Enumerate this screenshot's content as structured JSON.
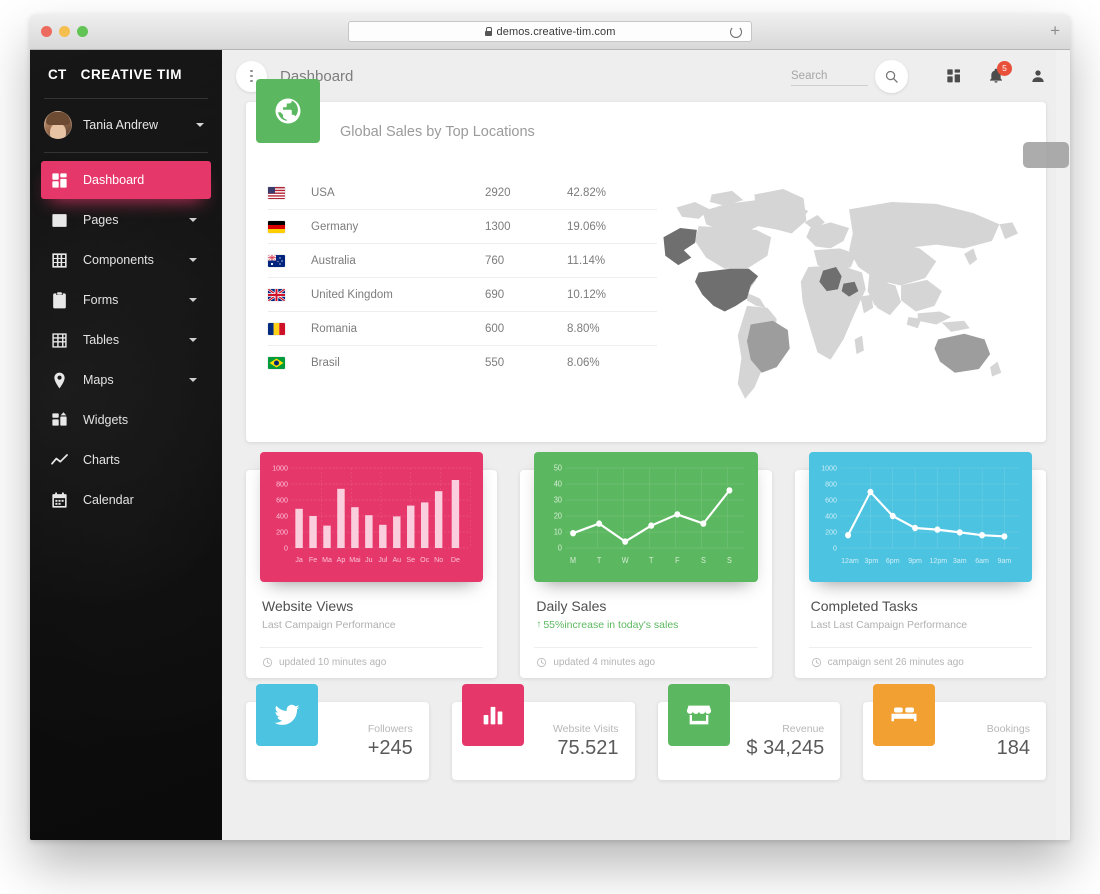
{
  "browser": {
    "url": "demos.creative-tim.com",
    "lock_icon": "lock-icon",
    "reload_icon": "reload-icon",
    "new_tab_label": "+"
  },
  "sidebar": {
    "brand_abbr": "CT",
    "brand_name": "CREATIVE TIM",
    "user": {
      "name": "Tania Andrew",
      "avatar_icon": "avatar",
      "caret_icon": "caret-down-icon"
    },
    "items": [
      {
        "label": "Dashboard",
        "icon": "dashboard-icon",
        "active": true,
        "caret": false
      },
      {
        "label": "Pages",
        "icon": "image-icon",
        "active": false,
        "caret": true
      },
      {
        "label": "Components",
        "icon": "grid-icon",
        "active": false,
        "caret": true
      },
      {
        "label": "Forms",
        "icon": "clipboard-icon",
        "active": false,
        "caret": true
      },
      {
        "label": "Tables",
        "icon": "table-icon",
        "active": false,
        "caret": true
      },
      {
        "label": "Maps",
        "icon": "pin-icon",
        "active": false,
        "caret": true
      },
      {
        "label": "Widgets",
        "icon": "widgets-icon",
        "active": false,
        "caret": false
      },
      {
        "label": "Charts",
        "icon": "chart-line-icon",
        "active": false,
        "caret": false
      },
      {
        "label": "Calendar",
        "icon": "calendar-icon",
        "active": false,
        "caret": false
      }
    ]
  },
  "topbar": {
    "menu_icon": "kebab-icon",
    "title": "Dashboard",
    "search_placeholder": "Search",
    "search_value": "",
    "search_icon": "search-icon",
    "apps_icon": "apps-grid-icon",
    "notifications_icon": "bell-icon",
    "notifications_count": "5",
    "profile_icon": "person-icon"
  },
  "map_card": {
    "title": "Global Sales by Top Locations",
    "icon": "globe-icon",
    "icon_color": "#5cb860",
    "rows": [
      {
        "flag": "us",
        "country": "USA",
        "sales": "2920",
        "percent": "42.82%"
      },
      {
        "flag": "de",
        "country": "Germany",
        "sales": "1300",
        "percent": "19.06%"
      },
      {
        "flag": "au",
        "country": "Australia",
        "sales": "760",
        "percent": "11.14%"
      },
      {
        "flag": "gb",
        "country": "United Kingdom",
        "sales": "690",
        "percent": "10.12%"
      },
      {
        "flag": "ro",
        "country": "Romania",
        "sales": "600",
        "percent": "8.80%"
      },
      {
        "flag": "br",
        "country": "Brasil",
        "sales": "550",
        "percent": "8.06%"
      }
    ],
    "highlighted_regions": [
      "United States",
      "Alaska",
      "Germany",
      "Romania",
      "Brazil",
      "Australia"
    ]
  },
  "chart_cards": [
    {
      "title": "Website Views",
      "subtitle": "Last Campaign Performance",
      "footer": "updated 10 minutes ago",
      "footer_icon": "clock-icon",
      "color": "#e6376b",
      "trend": false
    },
    {
      "title": "Daily Sales",
      "subtitle": "55%increase in today's sales",
      "footer": "updated 4 minutes ago",
      "footer_icon": "clock-icon",
      "color": "#5cb860",
      "trend": true,
      "trend_icon": "arrow-up-icon"
    },
    {
      "title": "Completed Tasks",
      "subtitle": "Last Last Campaign Performance",
      "footer": "campaign sent 26 minutes ago",
      "footer_icon": "clock-icon",
      "color": "#4cc3e0",
      "trend": false
    }
  ],
  "stat_cards": [
    {
      "icon": "twitter-icon",
      "color": "#4cc3e0",
      "label": "Followers",
      "value": "+245"
    },
    {
      "icon": "bar-chart-icon",
      "color": "#e6376b",
      "label": "Website Visits",
      "value": "75.521"
    },
    {
      "icon": "store-icon",
      "color": "#5cb860",
      "label": "Revenue",
      "value": "$ 34,245"
    },
    {
      "icon": "bed-icon",
      "color": "#f3a033",
      "label": "Bookings",
      "value": "184"
    }
  ],
  "chart_data": [
    {
      "type": "bar",
      "title": "Website Views",
      "categories": [
        "Ja",
        "Fe",
        "Ma",
        "Ap",
        "Mai",
        "Ju",
        "Jul",
        "Au",
        "Se",
        "Oc",
        "No",
        "De"
      ],
      "values": [
        490,
        400,
        280,
        740,
        510,
        410,
        290,
        395,
        530,
        570,
        710,
        850
      ],
      "yticks": [
        0,
        200,
        400,
        600,
        800,
        1000
      ],
      "ylim": [
        0,
        1000
      ],
      "xlabel": "",
      "ylabel": "",
      "grid": true,
      "legend": "none",
      "series_color": "#f8c4d5",
      "background": "#e6376b"
    },
    {
      "type": "line",
      "title": "Daily Sales",
      "categories": [
        "M",
        "T",
        "W",
        "T",
        "F",
        "S",
        "S"
      ],
      "values": [
        9,
        15,
        4,
        14,
        21,
        15,
        36
      ],
      "yticks": [
        0,
        10,
        20,
        30,
        40,
        50
      ],
      "ylim": [
        0,
        50
      ],
      "xlabel": "",
      "ylabel": "",
      "grid": true,
      "legend": "none",
      "series_color": "#ffffff",
      "background": "#5cb860"
    },
    {
      "type": "line",
      "title": "Completed Tasks",
      "categories": [
        "12am",
        "3pm",
        "6pm",
        "9pm",
        "12pm",
        "3am",
        "6am",
        "9am"
      ],
      "values": [
        160,
        700,
        400,
        250,
        230,
        195,
        160,
        145
      ],
      "yticks": [
        0,
        200,
        400,
        600,
        800,
        1000
      ],
      "ylim": [
        0,
        1000
      ],
      "xlabel": "",
      "ylabel": "",
      "grid": true,
      "legend": "none",
      "series_color": "#ffffff",
      "background": "#4cc3e0"
    }
  ]
}
